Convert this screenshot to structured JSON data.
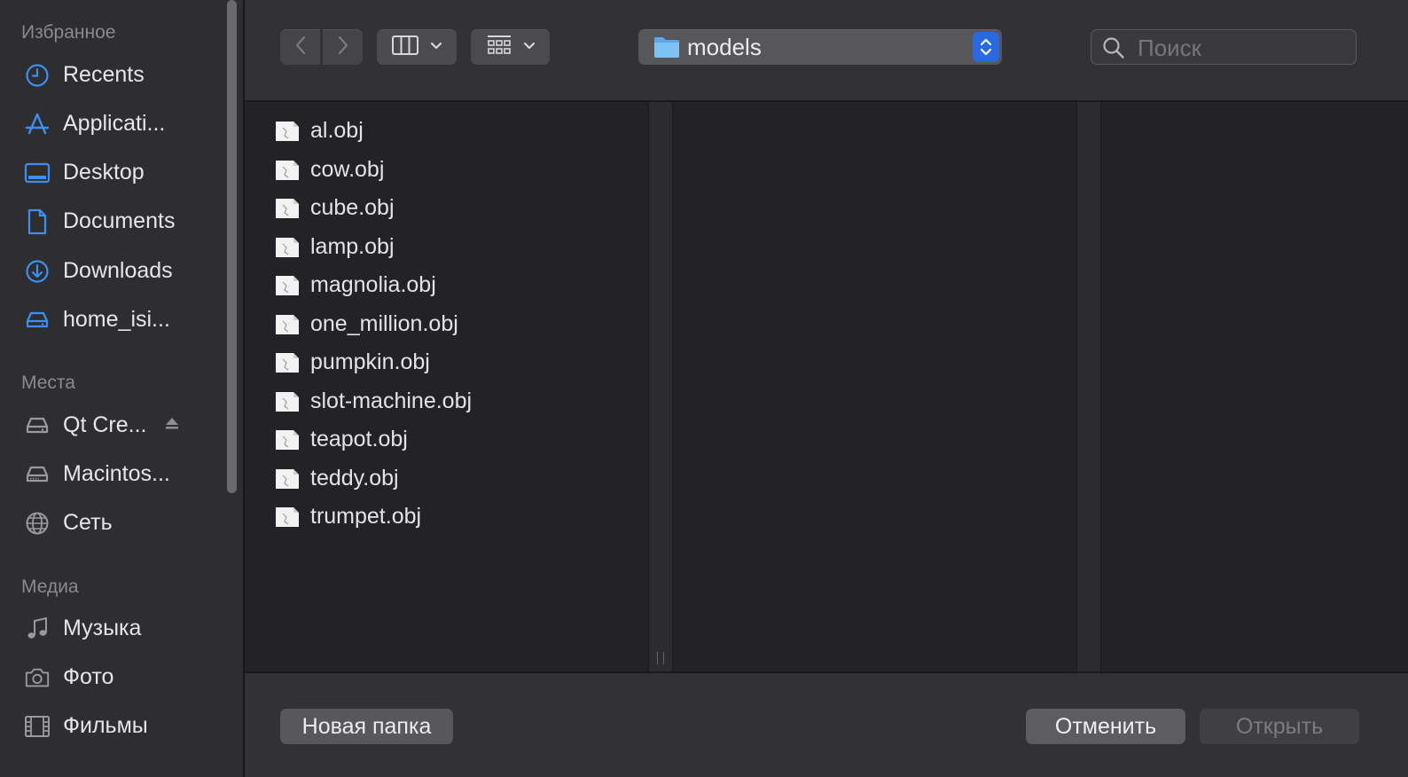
{
  "sidebar": {
    "favorites_title": "Избранное",
    "favorites": [
      {
        "label": "Recents",
        "icon": "clock-icon"
      },
      {
        "label": "Applicati...",
        "icon": "applications-icon"
      },
      {
        "label": "Desktop",
        "icon": "desktop-icon"
      },
      {
        "label": "Documents",
        "icon": "document-icon"
      },
      {
        "label": "Downloads",
        "icon": "download-icon"
      },
      {
        "label": "home_isi...",
        "icon": "drive-icon"
      }
    ],
    "places_title": "Места",
    "places": [
      {
        "label": "Qt Cre...",
        "icon": "drive-icon",
        "ejectable": true
      },
      {
        "label": "Macintos...",
        "icon": "drive-icon"
      },
      {
        "label": "Сеть",
        "icon": "globe-icon"
      }
    ],
    "media_title": "Медиа",
    "media": [
      {
        "label": "Музыка",
        "icon": "music-note-icon"
      },
      {
        "label": "Фото",
        "icon": "camera-icon"
      },
      {
        "label": "Фильмы",
        "icon": "film-icon"
      }
    ]
  },
  "toolbar": {
    "location": "models",
    "search_placeholder": "Поиск",
    "search_value": ""
  },
  "files": [
    "al.obj",
    "cow.obj",
    "cube.obj",
    "lamp.obj",
    "magnolia.obj",
    "one_million.obj",
    "pumpkin.obj",
    "slot-machine.obj",
    "teapot.obj",
    "teddy.obj",
    "trumpet.obj"
  ],
  "buttons": {
    "new_folder": "Новая папка",
    "cancel": "Отменить",
    "open": "Открыть"
  },
  "colors": {
    "accent": "#2a6ae0",
    "sidebar_icon": "#3b8ff5",
    "window_bg": "#232327"
  }
}
